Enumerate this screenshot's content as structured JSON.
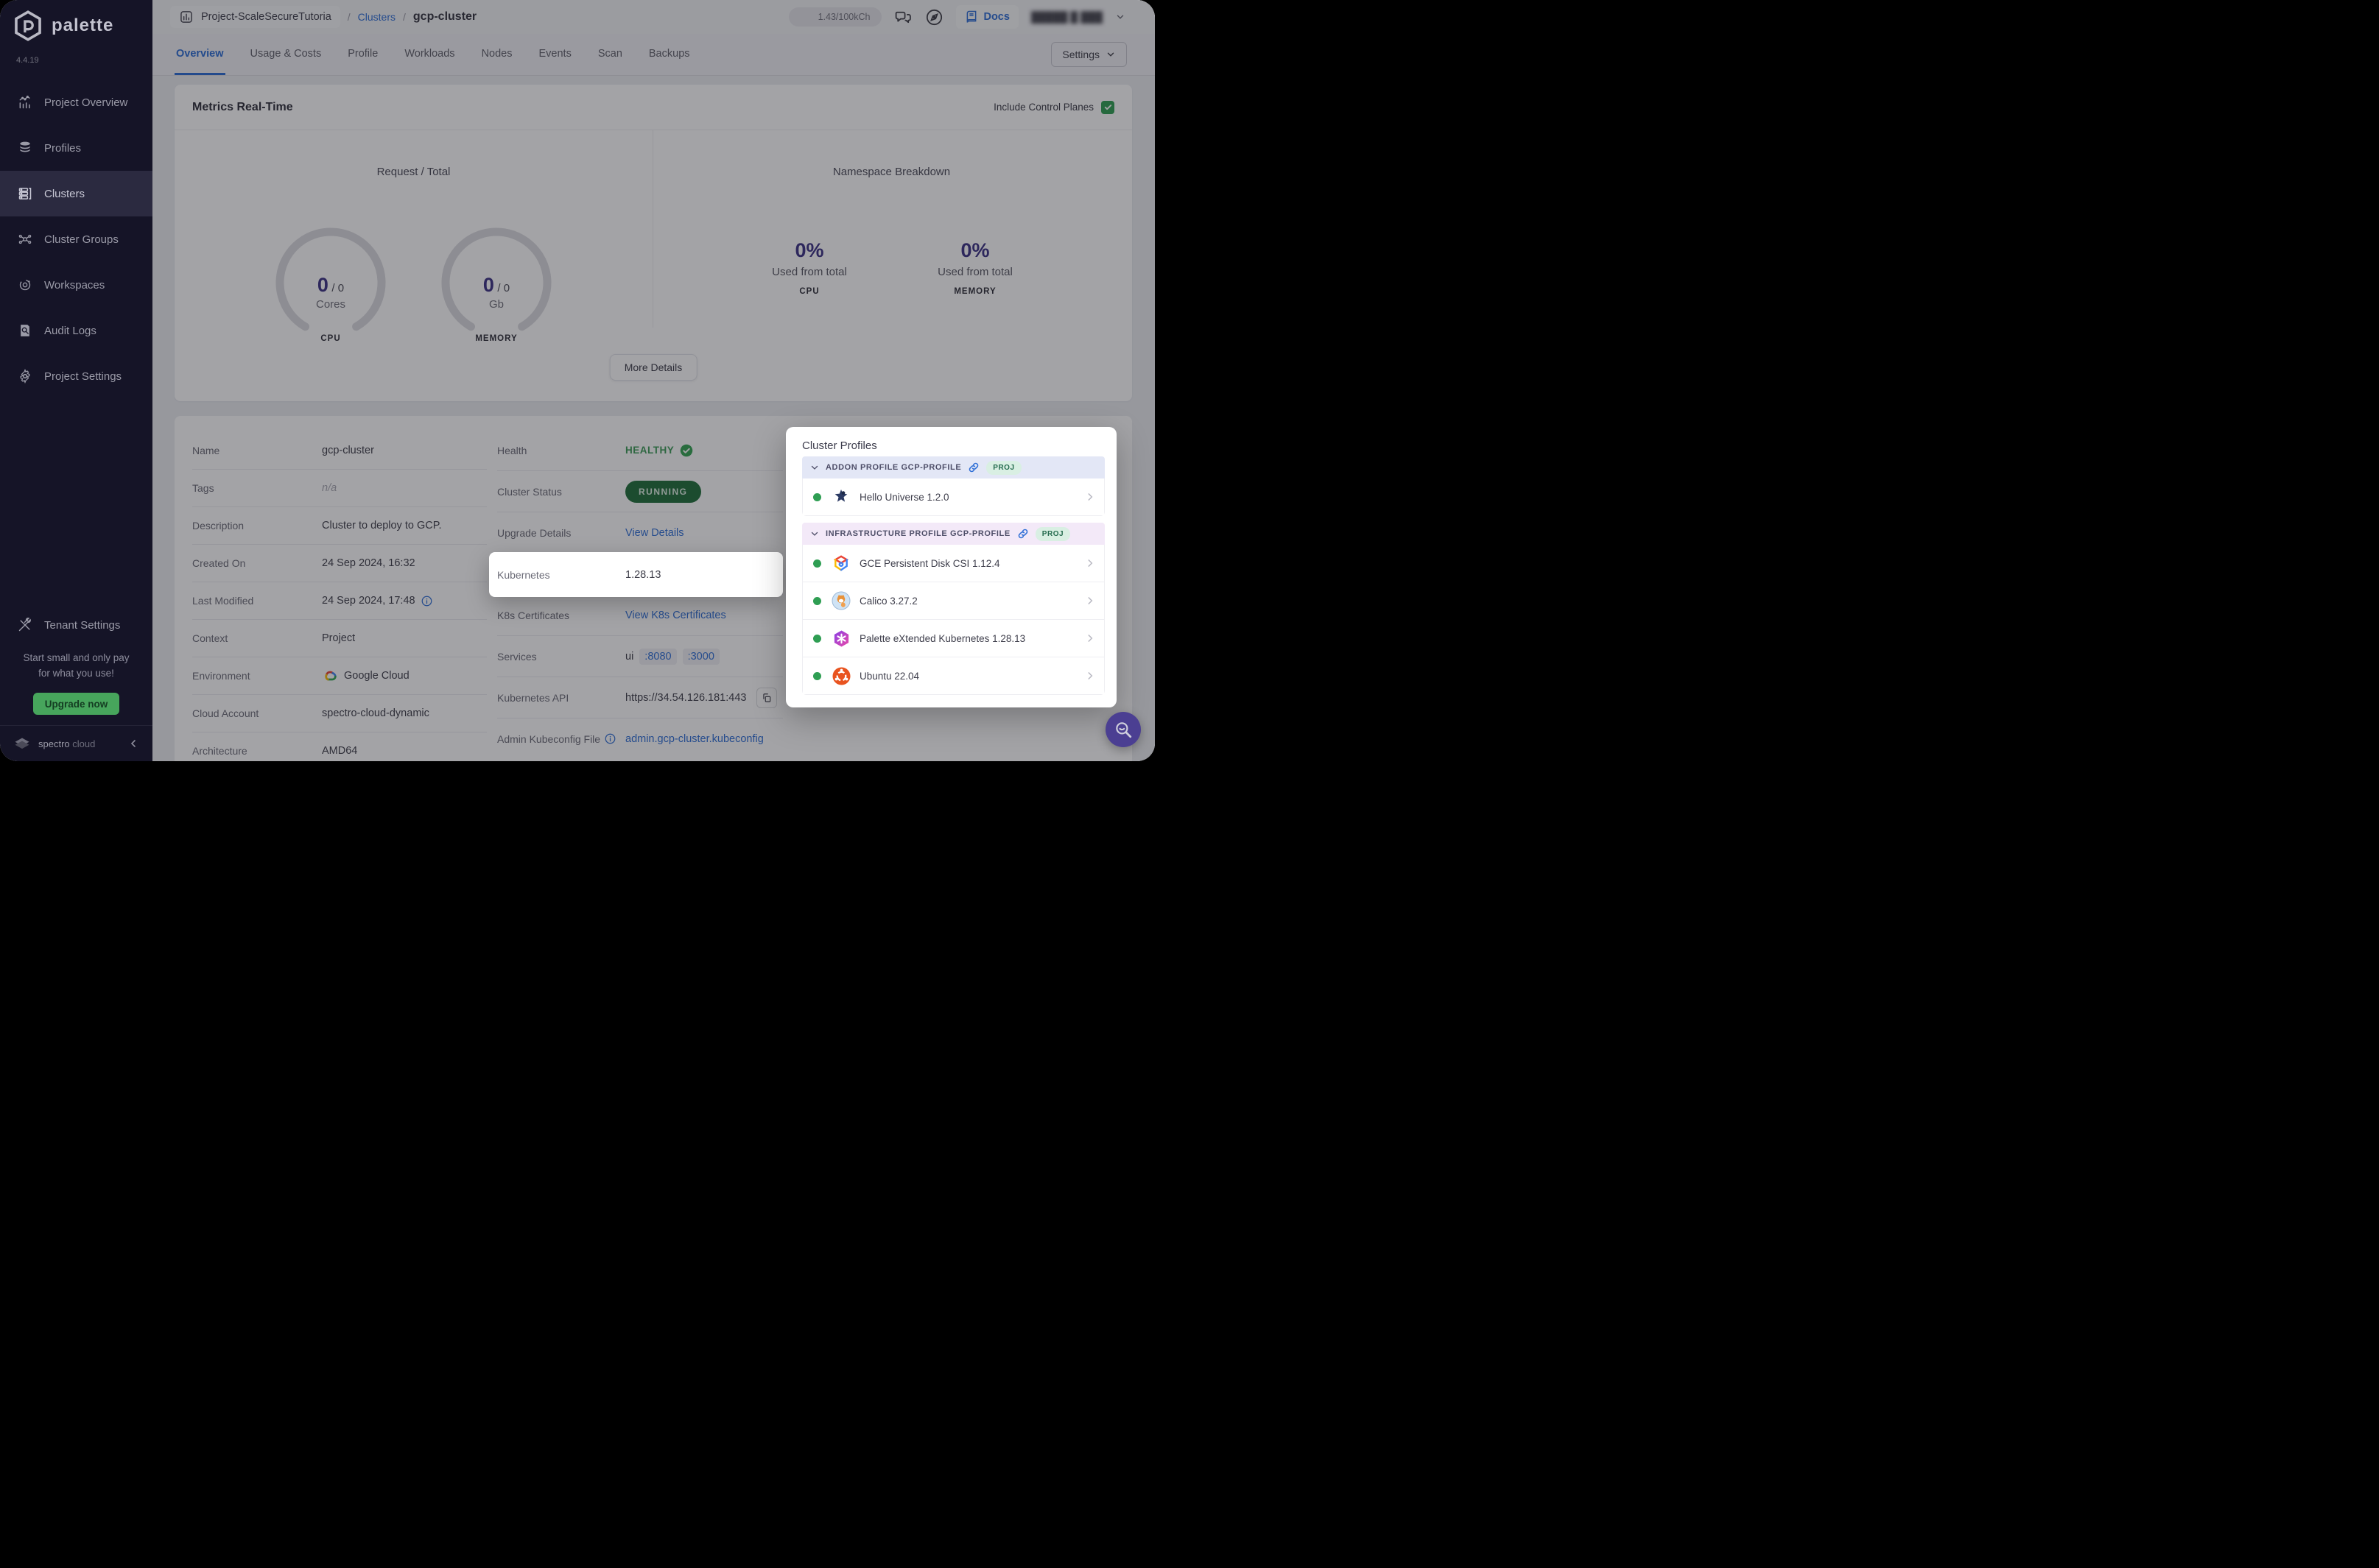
{
  "topbar": {
    "project": "Project-ScaleSecureTutoria",
    "sep": "/",
    "section_link": "Clusters",
    "page": "gcp-cluster",
    "usage": "1.43/100kCh",
    "docs": "Docs",
    "user": "█████ █ ███"
  },
  "tabs": {
    "items": [
      "Overview",
      "Usage & Costs",
      "Profile",
      "Workloads",
      "Nodes",
      "Events",
      "Scan",
      "Backups"
    ],
    "active": "Overview"
  },
  "settings_label": "Settings",
  "sidebar": {
    "brand": "palette",
    "version": "4.4.19",
    "items": [
      {
        "label": "Project Overview"
      },
      {
        "label": "Profiles"
      },
      {
        "label": "Clusters"
      },
      {
        "label": "Cluster Groups"
      },
      {
        "label": "Workspaces"
      },
      {
        "label": "Audit Logs"
      },
      {
        "label": "Project Settings"
      }
    ],
    "tenant": "Tenant Settings",
    "promo1": "Start small and only pay",
    "promo2": "for what you use!",
    "upgrade": "Upgrade now",
    "footer_brand": "spectro",
    "footer_brand2": "cloud"
  },
  "metrics": {
    "title": "Metrics Real-Time",
    "include_label": "Include Control Planes",
    "request_total": "Request / Total",
    "gauge_cpu": {
      "num": "0",
      "den": "/ 0",
      "unit": "Cores",
      "caption": "CPU"
    },
    "gauge_mem": {
      "num": "0",
      "den": "/ 0",
      "unit": "Gb",
      "caption": "MEMORY"
    },
    "namespace_title": "Namespace Breakdown",
    "ns_cpu": {
      "pct": "0%",
      "label": "Used from total",
      "caption": "CPU"
    },
    "ns_mem": {
      "pct": "0%",
      "label": "Used from total",
      "caption": "MEMORY"
    },
    "more": "More Details"
  },
  "details": {
    "left": [
      {
        "label": "Name",
        "value": "gcp-cluster"
      },
      {
        "label": "Tags",
        "value": "n/a"
      },
      {
        "label": "Description",
        "value": "Cluster to deploy to GCP."
      },
      {
        "label": "Created On",
        "value": "24 Sep 2024, 16:32"
      },
      {
        "label": "Last Modified",
        "value": "24 Sep 2024, 17:48"
      },
      {
        "label": "Context",
        "value": "Project"
      },
      {
        "label": "Environment",
        "value": "Google Cloud"
      },
      {
        "label": "Cloud Account",
        "value": "spectro-cloud-dynamic"
      },
      {
        "label": "Architecture",
        "value": "AMD64"
      }
    ],
    "right": {
      "health_label": "Health",
      "health_value": "HEALTHY",
      "status_label": "Cluster Status",
      "status_value": "RUNNING",
      "upgrade_label": "Upgrade Details",
      "upgrade_link": "View Details",
      "kubernetes_label": "Kubernetes",
      "kubernetes_value": "1.28.13",
      "certs_label": "K8s Certificates",
      "certs_link": "View K8s Certificates",
      "services_label": "Services",
      "services_name": "ui",
      "services_port1": ":8080",
      "services_port2": ":3000",
      "api_label": "Kubernetes API",
      "api_value": "https://34.54.126.181:443",
      "kubeconfig_label": "Admin Kubeconfig File",
      "kubeconfig_link": "admin.gcp-cluster.kubeconfig"
    }
  },
  "cluster_profiles": {
    "title": "Cluster Profiles",
    "addon_header": "ADDON PROFILE GCP-PROFILE",
    "addon_badge": "PROJ",
    "addon_items": [
      {
        "name": "Hello Universe 1.2.0",
        "icon": "hello-universe-icon"
      }
    ],
    "infra_header": "INFRASTRUCTURE PROFILE GCP-PROFILE",
    "infra_badge": "PROJ",
    "infra_items": [
      {
        "name": "GCE Persistent Disk CSI 1.12.4",
        "icon": "gce-disk-icon"
      },
      {
        "name": "Calico 3.27.2",
        "icon": "calico-icon"
      },
      {
        "name": "Palette eXtended Kubernetes 1.28.13",
        "icon": "palette-xk-icon"
      },
      {
        "name": "Ubuntu 22.04",
        "icon": "ubuntu-icon"
      }
    ]
  },
  "colors": {
    "accent_blue": "#2f6fd6",
    "green": "#2f9e53",
    "running_pill": "#1e6f3a",
    "stat_purple": "#3b3184",
    "fab_purple": "#4b3f92",
    "addon_header_bg": "#e3e7f6",
    "infra_header_bg": "#f3e9f8",
    "badge_bg": "#d9efe3"
  }
}
